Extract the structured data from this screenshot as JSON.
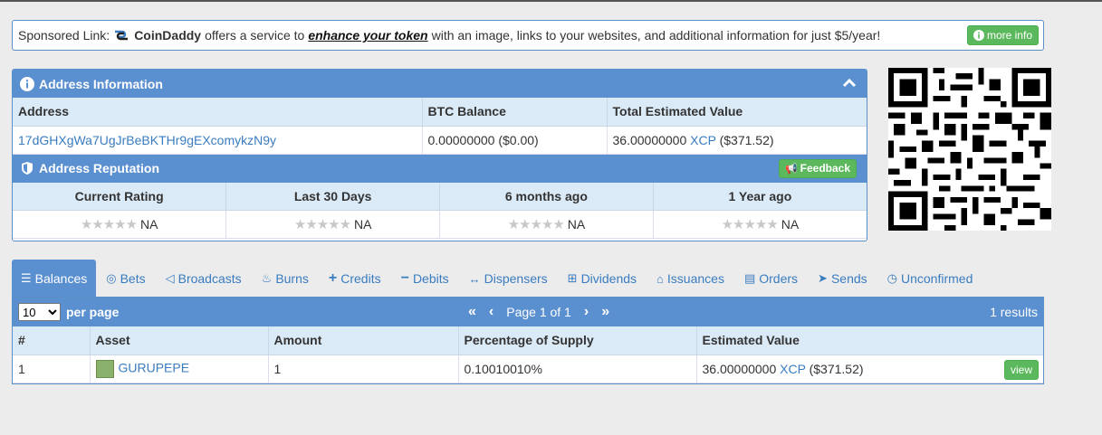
{
  "sponsor": {
    "prefix": "Sponsored Link:",
    "brand": "CoinDaddy",
    "text1": "offers a service to",
    "link": "enhance your token",
    "text2": "with an image, links to your websites, and additional information for just $5/year!",
    "more_info": "more info"
  },
  "address_panel": {
    "title": "Address Information",
    "headers": [
      "Address",
      "BTC Balance",
      "Total Estimated Value"
    ],
    "address": "17dGHXgWa7UgJrBeBKTHr9gEXcomykzN9y",
    "btc_balance": "0.00000000 ($0.00)",
    "total_value": "36.00000000",
    "total_unit": "XCP",
    "total_usd": "($371.52)"
  },
  "reputation": {
    "title": "Address Reputation",
    "feedback": "Feedback",
    "headers": [
      "Current Rating",
      "Last 30 Days",
      "6 months ago",
      "1 Year ago"
    ],
    "values": [
      "NA",
      "NA",
      "NA",
      "NA"
    ]
  },
  "tabs": [
    {
      "label": "Balances",
      "icon": "list-icon",
      "active": true
    },
    {
      "label": "Bets",
      "icon": "target-icon"
    },
    {
      "label": "Broadcasts",
      "icon": "megaphone-icon"
    },
    {
      "label": "Burns",
      "icon": "fire-icon"
    },
    {
      "label": "Credits",
      "icon": "plus-icon"
    },
    {
      "label": "Debits",
      "icon": "minus-icon"
    },
    {
      "label": "Dispensers",
      "icon": "arrows-icon"
    },
    {
      "label": "Dividends",
      "icon": "sitemap-icon"
    },
    {
      "label": "Issuances",
      "icon": "bank-icon"
    },
    {
      "label": "Orders",
      "icon": "book-icon"
    },
    {
      "label": "Sends",
      "icon": "paper-plane-icon"
    },
    {
      "label": "Unconfirmed",
      "icon": "clock-icon"
    }
  ],
  "balances": {
    "per_page_value": "10",
    "per_page_label": "per page",
    "page_text": "Page 1 of 1",
    "results": "1 results",
    "headers": [
      "#",
      "Asset",
      "Amount",
      "Percentage of Supply",
      "Estimated Value"
    ],
    "row": {
      "num": "1",
      "asset": "GURUPEPE",
      "amount": "1",
      "pct": "0.10010010%",
      "value": "36.00000000",
      "unit": "XCP",
      "usd": "($371.52)",
      "view": "view"
    }
  }
}
